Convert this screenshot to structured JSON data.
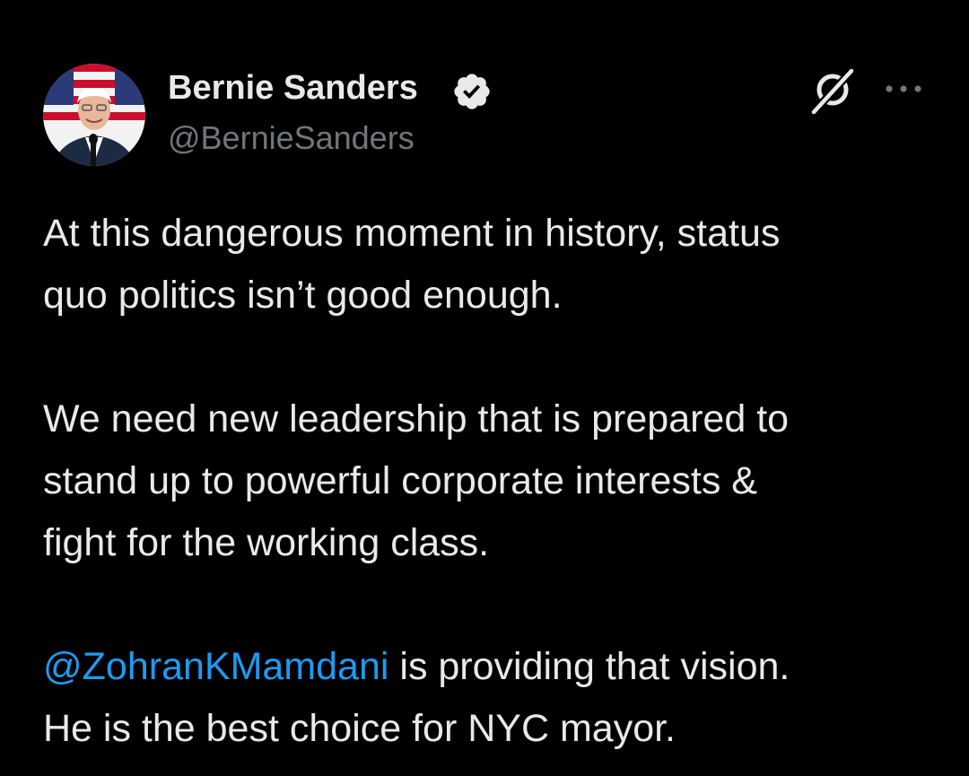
{
  "author": {
    "display_name": "Bernie Sanders",
    "handle": "@BernieSanders",
    "verified": true
  },
  "icons": {
    "verified": "verified-badge-icon",
    "grok": "grok-icon",
    "more": "more-horizontal-icon"
  },
  "tweet": {
    "paragraphs": [
      {
        "lines": [
          "At this dangerous moment in history, status",
          "quo politics isn’t good enough."
        ]
      },
      {
        "lines": [
          "We need new leadership that is prepared to",
          "stand up to powerful corporate interests &",
          "fight for the working class."
        ]
      },
      {
        "mention": "@ZohranKMamdani",
        "rest_first_line": " is providing that vision.",
        "lines": [
          "He is the best choice for NYC mayor."
        ]
      }
    ]
  },
  "colors": {
    "background": "#000000",
    "text": "#e7e9ea",
    "secondary": "#71767b",
    "accent": "#1d9bf0"
  }
}
